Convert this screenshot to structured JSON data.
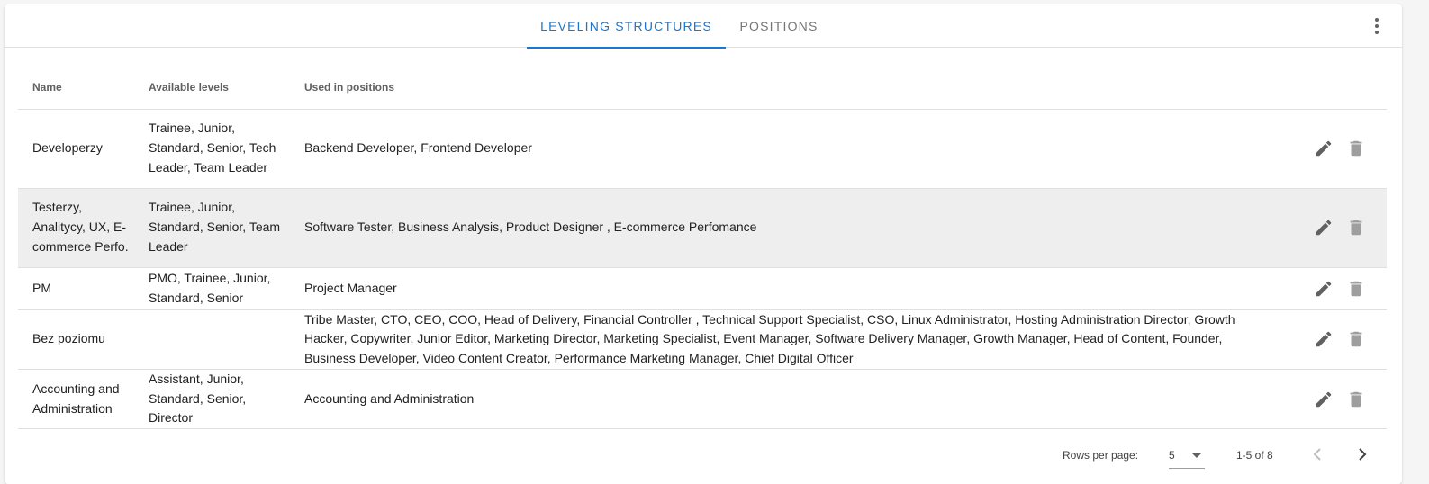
{
  "tabs": [
    {
      "label": "LEVELING STRUCTURES",
      "active": true
    },
    {
      "label": "POSITIONS",
      "active": false
    }
  ],
  "menu": {
    "icon": "more-vert-icon"
  },
  "table": {
    "headers": [
      "Name",
      "Available levels",
      "Used in positions"
    ],
    "rows": [
      {
        "name": "Developerzy",
        "levels": "Trainee, Junior, Standard, Senior, Tech Leader, Team Leader",
        "positions": "Backend Developer, Frontend Developer"
      },
      {
        "name": "Testerzy, Analitycy, UX, E-commerce Perfo.",
        "levels": "Trainee, Junior, Standard, Senior, Team Leader",
        "positions": "Software Tester, Business Analysis, Product Designer , E-commerce Perfomance"
      },
      {
        "name": "PM",
        "levels": "PMO, Trainee, Junior, Standard, Senior",
        "positions": "Project Manager"
      },
      {
        "name": "Bez poziomu",
        "levels": "",
        "positions": "Tribe Master, CTO, CEO, COO, Head of Delivery, Financial Controller , Technical Support Specialist, CSO, Linux Administrator, Hosting Administration Director, Growth Hacker, Copywriter, Junior Editor, Marketing Director, Marketing Specialist, Event Manager, Software Delivery Manager, Growth Manager, Head of Content, Founder, Business Developer, Video Content Creator, Performance Marketing Manager, Chief Digital Officer"
      },
      {
        "name": "Accounting and Administration",
        "levels": "Assistant, Junior, Standard, Senior, Director",
        "positions": "Accounting and Administration"
      }
    ],
    "actions": {
      "edit_icon": "pencil-icon",
      "delete_icon": "trash-icon"
    }
  },
  "pagination": {
    "rows_per_page_label": "Rows per page:",
    "rows_per_page_value": "5",
    "range": "1-5 of 8",
    "prev_icon": "chevron-left-icon",
    "next_icon": "chevron-right-icon"
  },
  "colors": {
    "accent": "#1976d2",
    "highlight_row": "#eeeeee",
    "icon_active": "#616161",
    "icon_muted": "#9e9e9e"
  }
}
